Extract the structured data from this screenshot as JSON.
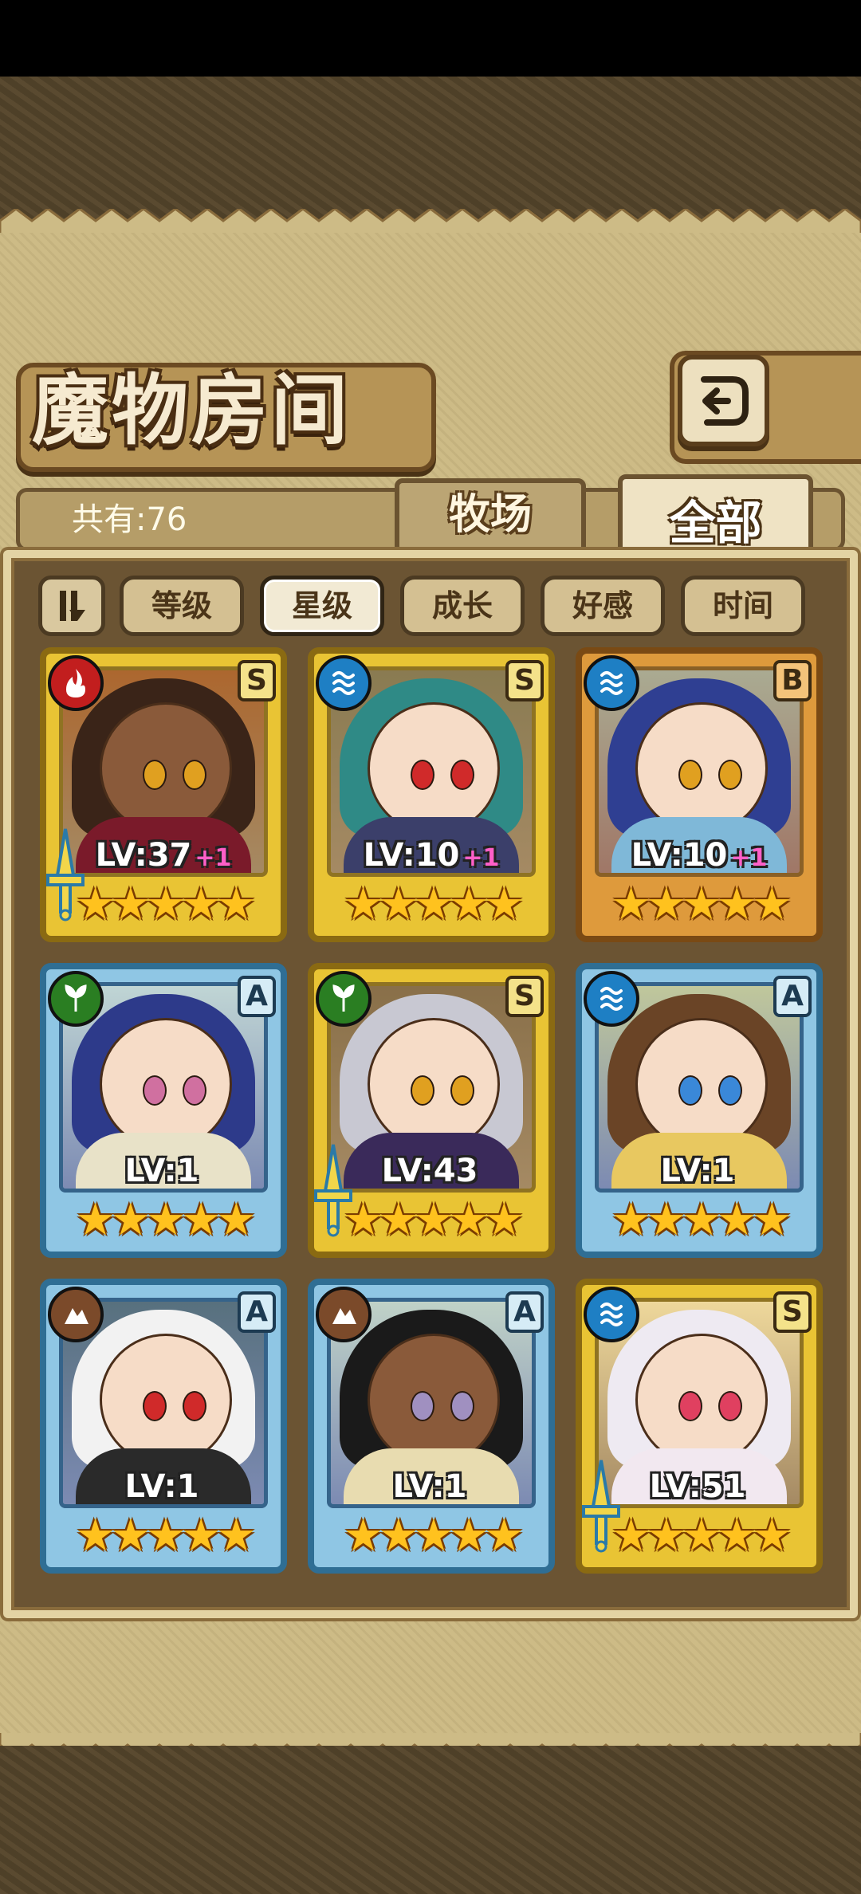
{
  "header": {
    "title": "魔物房间",
    "count_text": "共有:76"
  },
  "tabs": [
    {
      "label": "牧场",
      "active": false
    },
    {
      "label": "全部",
      "active": true
    }
  ],
  "sort": {
    "order_icon": "sort-order-icon",
    "buttons": [
      {
        "label": "等级",
        "active": false
      },
      {
        "label": "星级",
        "active": true
      },
      {
        "label": "成长",
        "active": false
      },
      {
        "label": "好感",
        "active": false
      },
      {
        "label": "时间",
        "active": false
      }
    ]
  },
  "monsters": [
    {
      "element": "fire",
      "rank": "S",
      "level": "LV:37",
      "plus": "+1",
      "stars": 5,
      "frame": "gold",
      "equipped": true,
      "hair": "#3a2418",
      "skin": "dark",
      "eyes": "#e0a020",
      "accent": "#7a1a2a"
    },
    {
      "element": "water",
      "rank": "S",
      "level": "LV:10",
      "plus": "+1",
      "stars": 5,
      "frame": "gold",
      "equipped": false,
      "hair": "#2f8a86",
      "skin": "light",
      "eyes": "#d02a2a",
      "accent": "#3b3f6a"
    },
    {
      "element": "water",
      "rank": "B",
      "level": "LV:10",
      "plus": "+1",
      "stars": 5,
      "frame": "bronze",
      "equipped": false,
      "hair": "#2f3f92",
      "skin": "light",
      "eyes": "#e0a020",
      "accent": "#7fb8d8"
    },
    {
      "element": "grass",
      "rank": "A",
      "level": "LV:1",
      "plus": "",
      "stars": 5,
      "frame": "silver",
      "equipped": false,
      "hair": "#2d3a8a",
      "skin": "light",
      "eyes": "#d070a0",
      "accent": "#e8e2c8"
    },
    {
      "element": "grass",
      "rank": "S",
      "level": "LV:43",
      "plus": "",
      "stars": 5,
      "frame": "gold",
      "equipped": true,
      "hair": "#c8c8d2",
      "skin": "light",
      "eyes": "#e0a020",
      "accent": "#3a2a5a"
    },
    {
      "element": "water",
      "rank": "A",
      "level": "LV:1",
      "plus": "",
      "stars": 5,
      "frame": "silver",
      "equipped": false,
      "hair": "#6a4426",
      "skin": "light",
      "eyes": "#3a88d8",
      "accent": "#e8c860"
    },
    {
      "element": "earth",
      "rank": "A",
      "level": "LV:1",
      "plus": "",
      "stars": 5,
      "frame": "silver",
      "equipped": false,
      "hair": "#f2f2f2",
      "skin": "light",
      "eyes": "#d02a2a",
      "accent": "#2a2a2a"
    },
    {
      "element": "earth",
      "rank": "A",
      "level": "LV:1",
      "plus": "",
      "stars": 5,
      "frame": "silver",
      "equipped": false,
      "hair": "#1a1a1a",
      "skin": "dark",
      "eyes": "#a090c0",
      "accent": "#e8dcb0"
    },
    {
      "element": "water",
      "rank": "S",
      "level": "LV:51",
      "plus": "",
      "stars": 5,
      "frame": "gold",
      "equipped": true,
      "hair": "#eeeaf2",
      "skin": "light",
      "eyes": "#e04060",
      "accent": "#f2e8f0"
    }
  ]
}
